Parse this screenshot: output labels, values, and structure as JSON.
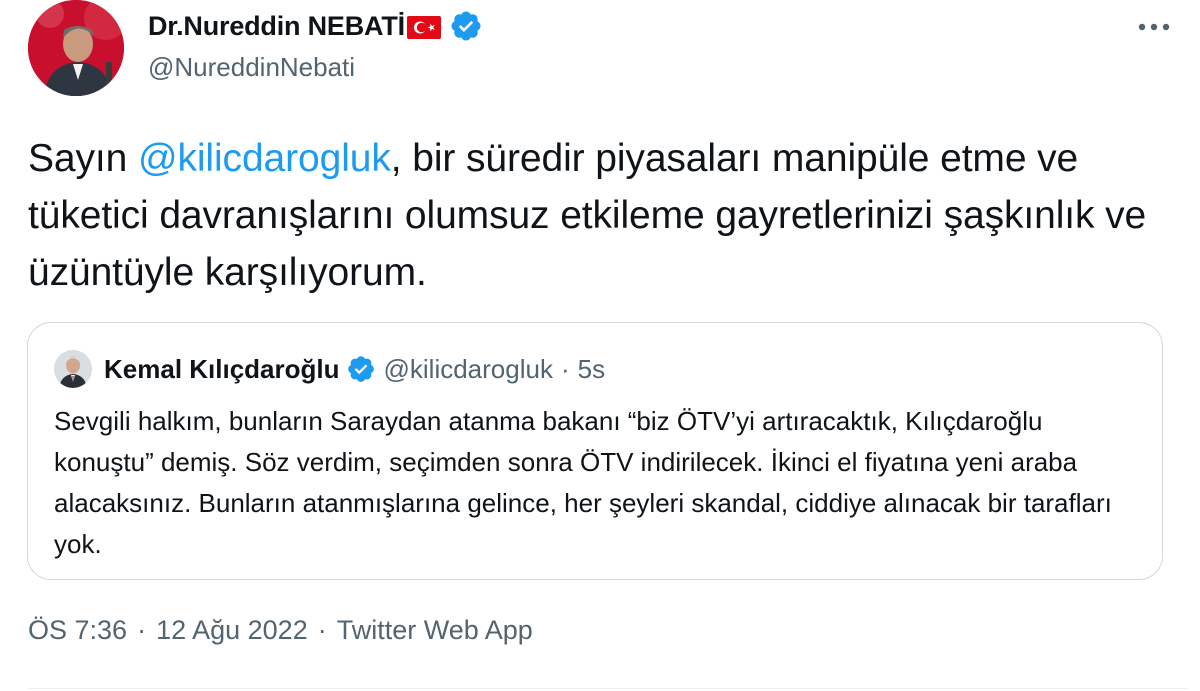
{
  "author": {
    "display_name": "Dr.Nureddin NEBATİ",
    "handle": "@NureddinNebati",
    "flag_icon": "turkey-flag-icon",
    "verified_icon": "verified-badge-icon"
  },
  "more_icon": "more-options-icon",
  "tweet": {
    "prefix": "Sayın ",
    "mention": "@kilicdarogluk",
    "text_rest": ", bir süredir piyasaları manipüle etme ve tüketici davranışlarını olumsuz etkileme gayretlerinizi şaşkınlık ve üzüntüyle karşılıyorum."
  },
  "quote": {
    "display_name": "Kemal Kılıçdaroğlu",
    "handle": "@kilicdarogluk",
    "dot": "·",
    "time": "5s",
    "text": "Sevgili halkım, bunların Saraydan atanma bakanı “biz ÖTV’yi artıracaktık, Kılıçdaroğlu konuştu” demiş. Söz verdim, seçimden sonra ÖTV indirilecek. İkinci el fiyatına yeni araba alacaksınız. Bunların atanmışlarına gelince, her şeyleri skandal, ciddiye alınacak bir tarafları yok."
  },
  "meta": {
    "time": "ÖS 7:36",
    "date": "12 Ağu 2022",
    "source": "Twitter Web App",
    "sep": "·"
  },
  "colors": {
    "link": "#1d9bf0",
    "secondary_text": "#536471",
    "border": "#cfd9de",
    "flag_red": "#e30a17"
  }
}
